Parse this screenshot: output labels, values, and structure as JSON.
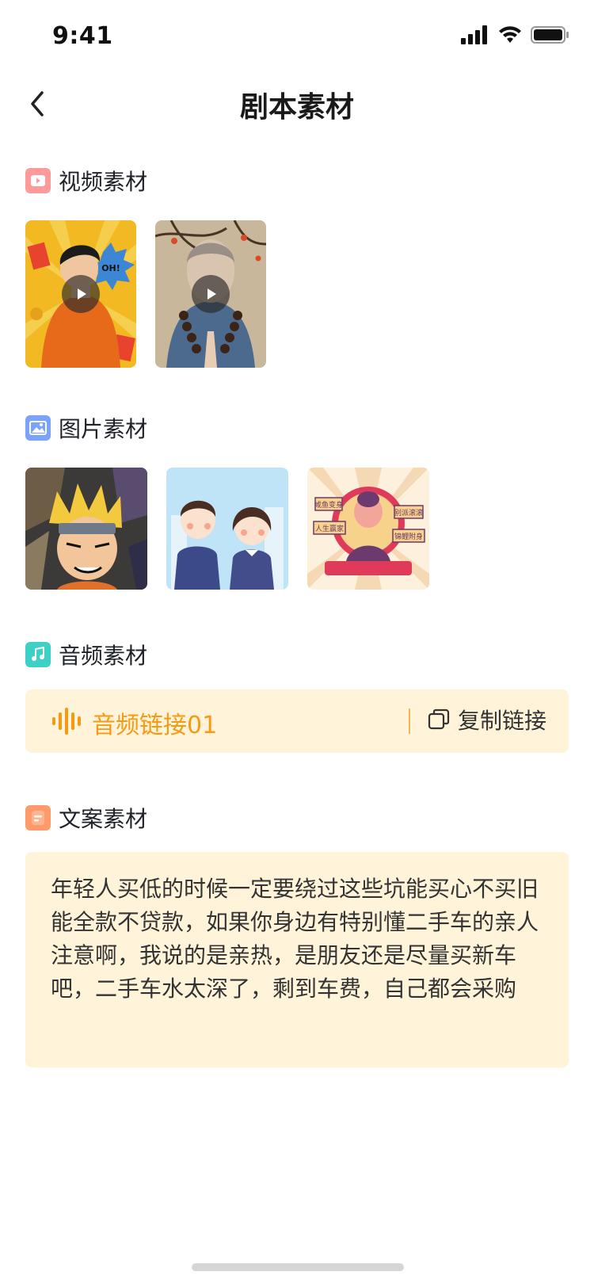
{
  "status_bar": {
    "time": "9:41"
  },
  "nav": {
    "title": "剧本素材"
  },
  "sections": {
    "video": {
      "title": "视频素材"
    },
    "image": {
      "title": "图片素材"
    },
    "audio": {
      "title": "音频素材"
    },
    "copy": {
      "title": "文案素材"
    }
  },
  "audio": {
    "name": "音频链接01",
    "copy_label": "复制链接"
  },
  "copy_text": "年轻人买低的时候一定要绕过这些坑能买心不买旧能全款不贷款，如果你身边有特别懂二手车的亲人注意啊，我说的是亲热，是朋友还是尽量买新车吧，二手车水太深了，剩到车费，自己都会采购",
  "images": {
    "poster3_labels": [
      "咸鱼变身",
      "别派滚滚",
      "人生赢家",
      "锦鲤附身"
    ]
  },
  "colors": {
    "accent_orange": "#f59a14",
    "card_bg": "#fff4d9",
    "video_icon": "#ff8a8a",
    "image_icon": "#6f9bff",
    "audio_icon": "#33c9c0",
    "copy_icon": "#ff9466"
  }
}
